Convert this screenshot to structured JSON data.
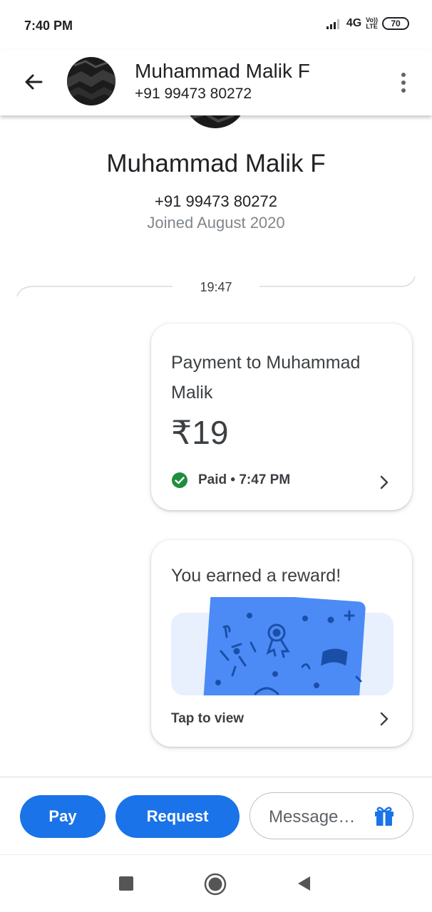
{
  "status_bar": {
    "time": "7:40 PM",
    "network": "4G",
    "volte": [
      "Vo))",
      "LTE"
    ],
    "battery": "70"
  },
  "header": {
    "name": "Muhammad Malik F",
    "phone": "+91 99473 80272",
    "icons": [
      "back-arrow-icon",
      "avatar",
      "more-vert-icon"
    ]
  },
  "profile": {
    "name": "Muhammad Malik F",
    "phone": "+91 99473 80272",
    "joined": "Joined August 2020"
  },
  "conversation": {
    "time": "19:47",
    "payment": {
      "title": "Payment to Muhammad Malik",
      "amount": "₹19",
      "status": "Paid • 7:47 PM",
      "status_color": "#1e8e3e"
    },
    "reward": {
      "title": "You earned a reward!",
      "cta": "Tap to view"
    }
  },
  "actions": {
    "pay_label": "Pay",
    "request_label": "Request",
    "message_placeholder": "Message…",
    "accent": "#1a73e8"
  },
  "nav": {
    "icons": [
      "recents-square-icon",
      "home-circle-icon",
      "back-triangle-icon"
    ]
  }
}
